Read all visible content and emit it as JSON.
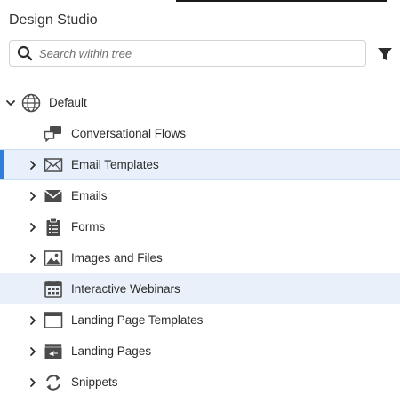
{
  "panel": {
    "title": "Design Studio"
  },
  "search": {
    "placeholder": "Search within tree",
    "value": ""
  },
  "tree": {
    "root": {
      "label": "Default",
      "icon": "globe-icon",
      "expanded": true
    },
    "items": [
      {
        "label": "Conversational Flows",
        "icon": "chat-icon",
        "expandable": false
      },
      {
        "label": "Email Templates",
        "icon": "envelope-outline-icon",
        "expandable": true,
        "state": "selected"
      },
      {
        "label": "Emails",
        "icon": "envelope-icon",
        "expandable": true
      },
      {
        "label": "Forms",
        "icon": "clipboard-icon",
        "expandable": true
      },
      {
        "label": "Images and Files",
        "icon": "image-icon",
        "expandable": true
      },
      {
        "label": "Interactive Webinars",
        "icon": "calendar-icon",
        "expandable": false,
        "state": "hover"
      },
      {
        "label": "Landing Page Templates",
        "icon": "page-template-icon",
        "expandable": true
      },
      {
        "label": "Landing Pages",
        "icon": "landing-page-icon",
        "expandable": true
      },
      {
        "label": "Snippets",
        "icon": "snippet-icon",
        "expandable": true
      }
    ]
  },
  "colors": {
    "accent": "#2f7ed8",
    "selected_bg": "#e8f1fb",
    "icon": "#4b4b4b"
  }
}
